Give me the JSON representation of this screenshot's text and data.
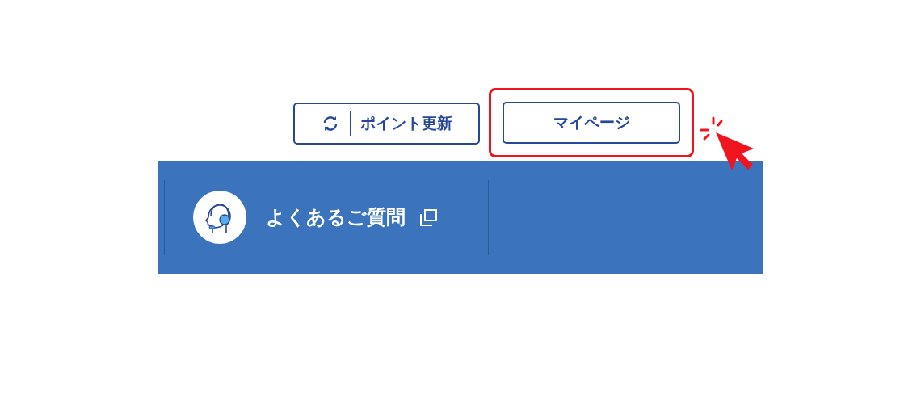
{
  "header_buttons": [
    {
      "kind": "refresh",
      "label": "ポイント更新",
      "highlighted": false
    },
    {
      "kind": "plain",
      "label": "マイページ",
      "highlighted": true
    }
  ],
  "nav": {
    "items": [
      {
        "label": "よくあるご質問",
        "external": true
      }
    ]
  }
}
